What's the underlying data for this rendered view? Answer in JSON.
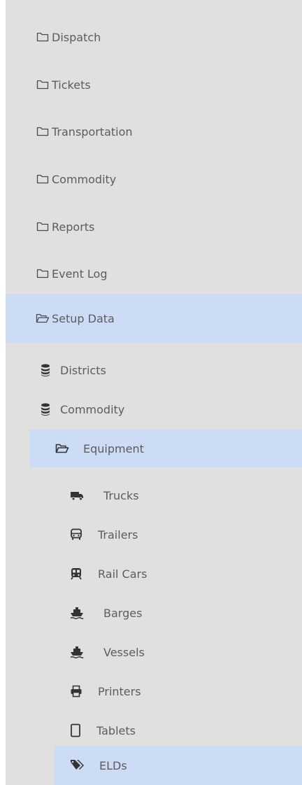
{
  "nav": {
    "top_items": [
      {
        "label": "Dispatch",
        "icon": "folder-icon"
      },
      {
        "label": "Tickets",
        "icon": "folder-icon"
      },
      {
        "label": "Transportation",
        "icon": "folder-icon"
      },
      {
        "label": "Commodity",
        "icon": "folder-icon"
      },
      {
        "label": "Reports",
        "icon": "folder-icon"
      },
      {
        "label": "Event Log",
        "icon": "folder-icon"
      },
      {
        "label": "Setup Data",
        "icon": "folder-open-icon",
        "expanded": true
      }
    ],
    "setup_items": [
      {
        "label": "Districts",
        "icon": "database-icon"
      },
      {
        "label": "Commodity",
        "icon": "database-icon"
      },
      {
        "label": "Equipment",
        "icon": "folder-open-icon",
        "expanded": true
      }
    ],
    "equipment_items": [
      {
        "label": "Trucks",
        "icon": "truck-icon"
      },
      {
        "label": "Trailers",
        "icon": "bus-icon"
      },
      {
        "label": "Rail Cars",
        "icon": "train-icon"
      },
      {
        "label": "Barges",
        "icon": "ship-icon"
      },
      {
        "label": "Vessels",
        "icon": "ship-icon"
      },
      {
        "label": "Printers",
        "icon": "print-icon"
      },
      {
        "label": "Tablets",
        "icon": "tablet-icon"
      },
      {
        "label": "ELDs",
        "icon": "tags-icon",
        "selected": true
      }
    ]
  },
  "colors": {
    "panel_bg": "#e0e0e0",
    "highlight": "#cddcf5",
    "text": "#5c5c5c",
    "icon_dark": "#333333"
  }
}
